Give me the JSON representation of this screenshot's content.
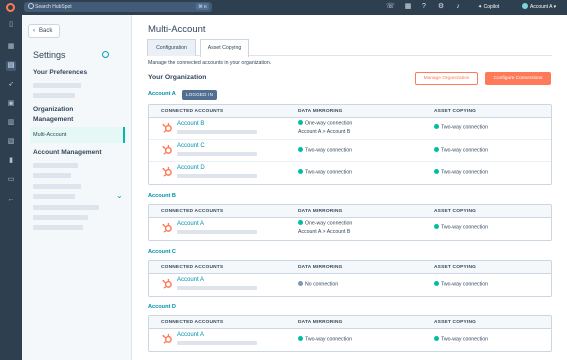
{
  "topbar": {
    "search_placeholder": "Search HubSpot",
    "shortcut": "⌘ K",
    "copilot_label": "Copilot",
    "account_label": "Account A ▾"
  },
  "sidebar": {
    "back_label": "Back",
    "title": "Settings",
    "sections": {
      "preferences": "Your Preferences",
      "organization": "Organization\nManagement",
      "account_management": "Account Management"
    },
    "active_item": "Multi-Account"
  },
  "main": {
    "title": "Multi-Account",
    "tabs": [
      "Configuration",
      "Asset Copying"
    ],
    "active_tab": "Asset Copying",
    "description": "Manage the connected accounts in your organization.",
    "org_heading": "Your Organization",
    "manage_button": "Manage Organization",
    "configure_button": "Configure Connections",
    "logged_in_badge": "LOGGED IN",
    "columns": [
      "CONNECTED ACCOUNTS",
      "DATA MIRRORING",
      "ASSET COPYING"
    ],
    "groups": [
      {
        "account": "Account A",
        "rows": [
          {
            "name": "Account B",
            "mirroring": "One-way connection",
            "mirroring_sub": "Account A > Account B",
            "copying": "Two-way connection"
          },
          {
            "name": "Account C",
            "mirroring": "Two-way connection",
            "mirroring_sub": "",
            "copying": "Two-way connection"
          },
          {
            "name": "Account D",
            "mirroring": "Two-way connection",
            "mirroring_sub": "",
            "copying": "Two-way connection"
          }
        ]
      },
      {
        "account": "Account B",
        "rows": [
          {
            "name": "Account A",
            "mirroring": "One-way connection",
            "mirroring_sub": "Account A > Account B",
            "copying": "Two-way connection"
          }
        ]
      },
      {
        "account": "Account C",
        "rows": [
          {
            "name": "Account A",
            "mirroring": "No connection",
            "mirroring_sub": "",
            "copying": "Two-way connection"
          }
        ]
      },
      {
        "account": "Account D",
        "rows": [
          {
            "name": "Account A",
            "mirroring": "Two-way connection",
            "mirroring_sub": "",
            "copying": "Two-way connection"
          }
        ]
      }
    ]
  },
  "colors": {
    "accent": "#ff7a59",
    "link": "#0091ae",
    "connected": "#00bda5",
    "no_connection": "#7c98b6",
    "nav_bg": "#2e3f50"
  }
}
